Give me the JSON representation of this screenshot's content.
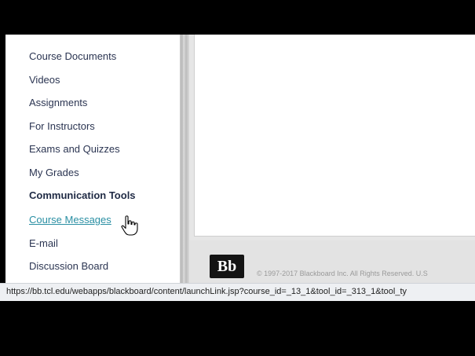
{
  "sidebar": {
    "items": [
      {
        "label": "Course Documents"
      },
      {
        "label": "Videos"
      },
      {
        "label": "Assignments"
      },
      {
        "label": "For Instructors"
      },
      {
        "label": "Exams and Quizzes"
      },
      {
        "label": "My Grades"
      },
      {
        "label": "Communication Tools"
      },
      {
        "label": "Course Messages"
      },
      {
        "label": "E-mail"
      },
      {
        "label": "Discussion Board"
      }
    ]
  },
  "footer": {
    "logo": "Bb",
    "copyright": "© 1997-2017 Blackboard Inc. All Rights Reserved. U.S"
  },
  "status_bar": {
    "url": "https://bb.tcl.edu/webapps/blackboard/content/launchLink.jsp?course_id=_13_1&tool_id=_313_1&tool_ty"
  }
}
